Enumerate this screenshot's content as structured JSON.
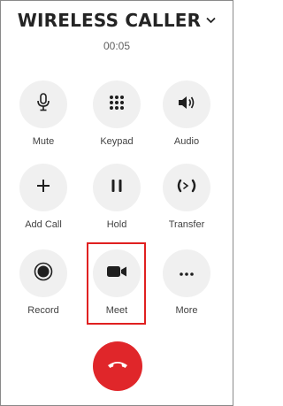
{
  "call": {
    "caller_name": "WIRELESS CALLER",
    "duration": "00:05"
  },
  "controls": [
    {
      "label": "Mute",
      "icon": "microphone-icon"
    },
    {
      "label": "Keypad",
      "icon": "keypad-icon"
    },
    {
      "label": "Audio",
      "icon": "speaker-icon"
    },
    {
      "label": "Add Call",
      "icon": "plus-icon"
    },
    {
      "label": "Hold",
      "icon": "pause-icon"
    },
    {
      "label": "Transfer",
      "icon": "transfer-icon"
    },
    {
      "label": "Record",
      "icon": "record-icon"
    },
    {
      "label": "Meet",
      "icon": "video-camera-icon",
      "highlighted": true
    },
    {
      "label": "More",
      "icon": "more-icon"
    }
  ],
  "hangup": {
    "icon": "hang-up-icon"
  },
  "colors": {
    "control_bg": "#f0f0f0",
    "icon": "#1f1f1f",
    "hangup_red": "#e0262a",
    "highlight_border": "#e02020"
  }
}
